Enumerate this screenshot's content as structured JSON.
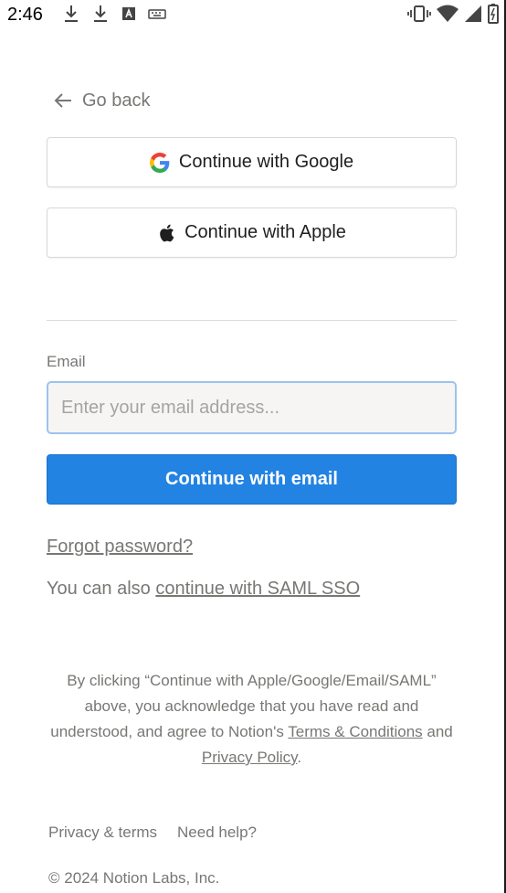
{
  "status_bar": {
    "time": "2:46",
    "left_icons": [
      "download-icon",
      "download-icon",
      "a-box-icon",
      "keyboard-icon"
    ],
    "right_icons": [
      "vibrate-icon",
      "wifi-icon",
      "signal-icon",
      "battery-icon"
    ]
  },
  "nav": {
    "go_back_label": "Go back"
  },
  "auth": {
    "google_label": "Continue with Google",
    "apple_label": "Continue with Apple"
  },
  "email": {
    "label": "Email",
    "placeholder": "Enter your email address...",
    "value": "",
    "continue_label": "Continue with email"
  },
  "links": {
    "forgot_password": "Forgot password?",
    "saml_prefix": "You can also ",
    "saml_link": "continue with SAML SSO"
  },
  "legal": {
    "text_before": "By clicking “Continue with Apple/Google/Email/SAML” above, you acknowledge that you have read and understood, and agree to Notion's ",
    "terms_link": "Terms & Conditions",
    "text_middle": " and ",
    "privacy_link": "Privacy Policy",
    "text_after": "."
  },
  "footer": {
    "privacy_terms": "Privacy & terms",
    "need_help": "Need help?",
    "copyright": "© 2024 Notion Labs, Inc."
  },
  "colors": {
    "primary": "#2383e2",
    "muted_text": "#787774",
    "input_focus_border": "#9cc3ee"
  }
}
